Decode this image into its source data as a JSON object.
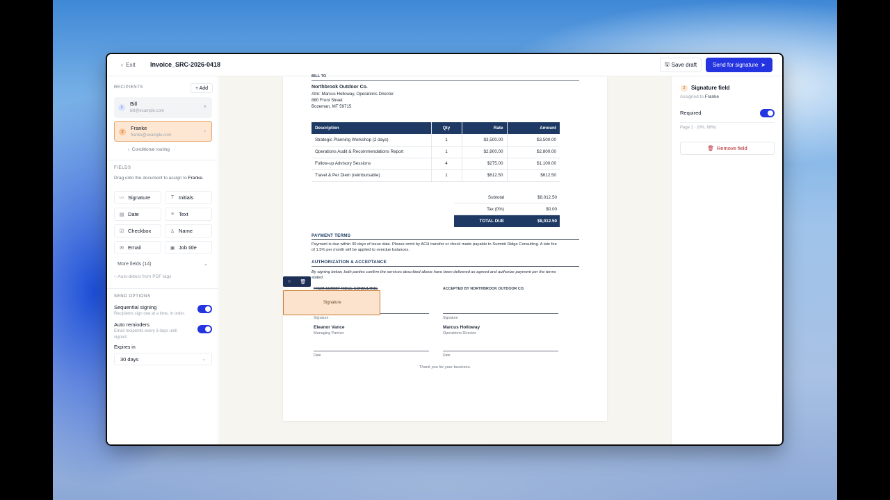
{
  "topbar": {
    "exit_label": "Exit",
    "doc_title": "Invoice_SRC-2026-0418",
    "save_draft": "Save draft",
    "send_for_signature": "Send for signature"
  },
  "recipients": {
    "section_title": "RECIPIENTS",
    "add_label": "+ Add",
    "items": [
      {
        "num": "1",
        "name": "Bill",
        "email": "bill@example.com"
      },
      {
        "num": "2",
        "name": "Franke",
        "email": "franke@example.com"
      }
    ],
    "routing": "Conditional routing"
  },
  "fields": {
    "section_title": "FIELDS",
    "hint": "Drag onto the document to assign to",
    "hint_name": "Franke.",
    "items": [
      "Signature",
      "Initials",
      "Date",
      "Text",
      "Checkbox",
      "Name",
      "Email",
      "Job title"
    ],
    "more": "More fields (14)",
    "autodetect": "Auto-detect from PDF tags"
  },
  "send_options": {
    "section_title": "SEND OPTIONS",
    "sequential": {
      "label": "Sequential signing",
      "desc": "Recipients sign one at a time, in order.",
      "on": true
    },
    "reminders": {
      "label": "Auto reminders",
      "desc": "Email recipients every 3 days until signed.",
      "on": true
    },
    "expires_label": "Expires in",
    "expires_value": "30 days"
  },
  "document": {
    "bill_to": "BILL TO",
    "company": "Northbrook Outdoor Co.",
    "attn": "Attn: Marcus Holloway, Operations Director",
    "street": "880 Front Street",
    "city": "Bozeman, MT 59715",
    "table": {
      "headers": [
        "Description",
        "Qty",
        "Rate",
        "Amount"
      ],
      "rows": [
        [
          "Strategic Planning Workshop (2 days)",
          "1",
          "$3,500.00",
          "$3,500.00"
        ],
        [
          "Operations Audit & Recommendations Report",
          "1",
          "$2,800.00",
          "$2,800.00"
        ],
        [
          "Follow-up Advisory Sessions",
          "4",
          "$275.00",
          "$1,100.00"
        ],
        [
          "Travel & Per Diem (reimbursable)",
          "1",
          "$612.50",
          "$612.50"
        ]
      ]
    },
    "subtotal_label": "Subtotal",
    "subtotal": "$8,012.50",
    "tax_label": "Tax (0%)",
    "tax": "$0.00",
    "total_label": "TOTAL DUE",
    "total": "$8,012.50",
    "payment_title": "PAYMENT TERMS",
    "payment_text1": "Payment is due within 30 days of issue date. Please remit by ACH transfer or check made payable to Summit Ridge Consulting. A late fee",
    "payment_text2": "of 1.5% per month will be applied to overdue balances.",
    "auth_title": "AUTHORIZATION & ACCEPTANCE",
    "auth_text1": "By signing below, both parties confirm the services described above have been delivered as agreed and authorize payment per the terms",
    "auth_text2": "stated.",
    "from_label": "FROM SUMMIT RIDGE CONSULTING",
    "accepted_label": "ACCEPTED BY NORTHBROOK OUTDOOR CO.",
    "signature_caption": "Signature",
    "date_caption": "Date",
    "left_signer": "Eleanor Vance",
    "left_role": "Managing Partner",
    "right_signer": "Marcus Holloway",
    "right_role": "Operations Director",
    "placed_field_label": "Signature",
    "thanks": "Thank you for your business."
  },
  "field_panel": {
    "num": "2",
    "title": "Signature field",
    "assigned_prefix": "Assigned to",
    "assigned_to": "Franke",
    "required_label": "Required",
    "required_on": true,
    "position": "Page 1 · (0%, 68%)",
    "remove_label": "Remove field"
  },
  "colors": {
    "accent": "#2434e0",
    "navy": "#1e3a64",
    "field_fill": "#fbe3cd",
    "field_border": "#c97b2e"
  }
}
